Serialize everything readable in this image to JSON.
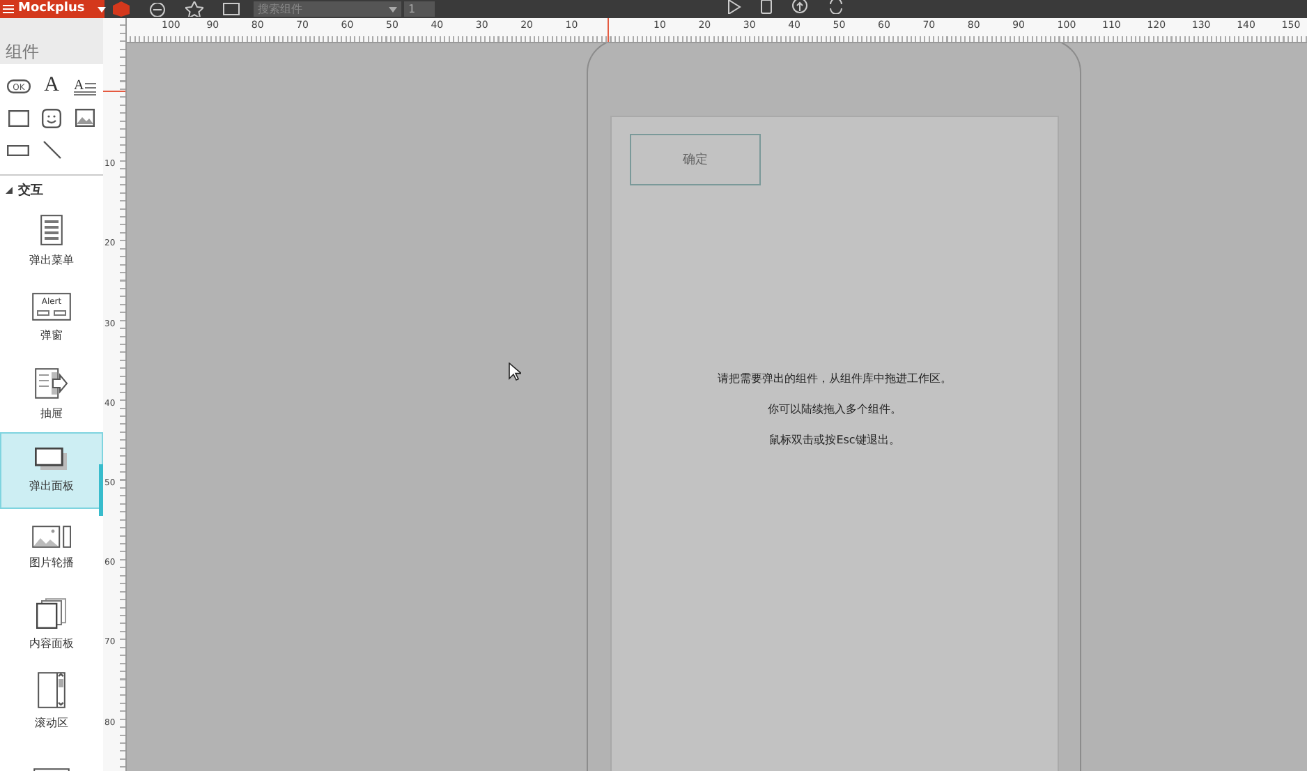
{
  "toolbar": {
    "app_name": "Mockplus",
    "search": {
      "placeholder": "搜索组件"
    },
    "page_field": "1"
  },
  "ruler": {
    "left_labels": [
      "100",
      "90",
      "80",
      "70",
      "60",
      "50",
      "40",
      "30",
      "20",
      "10"
    ],
    "right_labels": [
      "10",
      "20",
      "30",
      "40",
      "50",
      "60",
      "70",
      "80",
      "90",
      "100",
      "110",
      "120",
      "130",
      "140",
      "150"
    ],
    "vertical_labels": [
      "10",
      "20",
      "30",
      "40",
      "50",
      "60",
      "70",
      "80"
    ]
  },
  "sidebar": {
    "title": "组件",
    "tools": [
      {
        "kind": "button",
        "text": "OK"
      },
      {
        "kind": "text",
        "text": "A"
      },
      {
        "kind": "paragraph",
        "text": "A"
      },
      {
        "kind": "rect"
      },
      {
        "kind": "face"
      },
      {
        "kind": "image"
      },
      {
        "kind": "input"
      },
      {
        "kind": "line"
      }
    ],
    "section": {
      "label": "交互",
      "expanded": true
    },
    "items": [
      {
        "label": "弹出菜单",
        "kind": "menu",
        "selected": false
      },
      {
        "label": "弹窗",
        "kind": "alert",
        "icon_text": "Alert",
        "selected": false
      },
      {
        "label": "抽屉",
        "kind": "drawer",
        "selected": false
      },
      {
        "label": "弹出面板",
        "kind": "panel",
        "selected": true
      },
      {
        "label": "图片轮播",
        "kind": "carousel",
        "selected": false
      },
      {
        "label": "内容面板",
        "kind": "pages",
        "selected": false
      },
      {
        "label": "滚动区",
        "kind": "scroll",
        "selected": false
      },
      {
        "kind": "rect",
        "selected": false
      }
    ]
  },
  "canvas": {
    "button": "确定",
    "hints": [
      "请把需要弹出的组件，从组件库中拖进工作区。",
      "你可以陆续拖入多个组件。",
      "鼠标双击或按Esc键退出。"
    ]
  }
}
